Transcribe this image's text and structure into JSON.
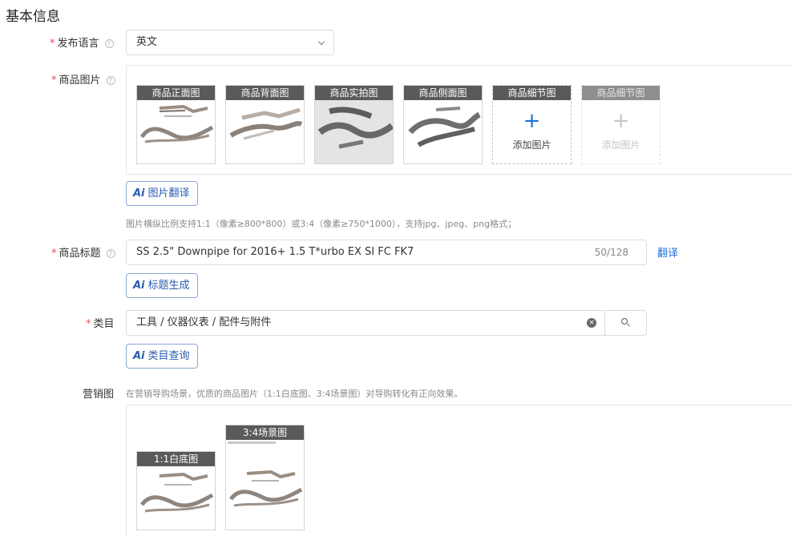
{
  "section_title": "基本信息",
  "language": {
    "label": "发布语言",
    "value": "英文",
    "help_icon": "question-circle-icon"
  },
  "product_images": {
    "label": "商品图片",
    "cards": [
      {
        "caption": "商品正面图",
        "type": "image"
      },
      {
        "caption": "商品背面图",
        "type": "image"
      },
      {
        "caption": "商品实拍图",
        "type": "image"
      },
      {
        "caption": "商品侧面图",
        "type": "image"
      },
      {
        "caption": "商品细节图",
        "type": "add",
        "add_text": "添加图片",
        "plus": "+"
      },
      {
        "caption": "商品细节图",
        "type": "add-disabled",
        "add_text": "添加图片",
        "plus": "+"
      }
    ],
    "ai_button": {
      "ai": "Ai",
      "label": "图片翻译"
    },
    "hint": "图片横纵比例支持1:1（像素≥800*800）或3:4（像素≥750*1000），支持jpg、jpeg、png格式；"
  },
  "title": {
    "label": "商品标题",
    "value": "SS 2.5\" Downpipe for 2016+ 1.5 T*urbo EX SI FC FK7",
    "counter": "50/128",
    "translate_link": "翻译",
    "ai_button": {
      "ai": "Ai",
      "label": "标题生成"
    }
  },
  "category": {
    "label": "类目",
    "value": "工具 / 仪器仪表 / 配件与附件",
    "clear_symbol": "×",
    "ai_button": {
      "ai": "Ai",
      "label": "类目查询"
    }
  },
  "marketing": {
    "label": "营销图",
    "hint": "在营销导购场景，优质的商品图片（1:1白底图、3:4场景图）对导购转化有正向效果。",
    "cards": [
      {
        "caption": "1:1白底图"
      },
      {
        "caption": "3:4场景图"
      }
    ]
  },
  "colors": {
    "accent": "#1f6fd6",
    "required": "#e34d59",
    "caption_bg": "#5a5a5a"
  }
}
